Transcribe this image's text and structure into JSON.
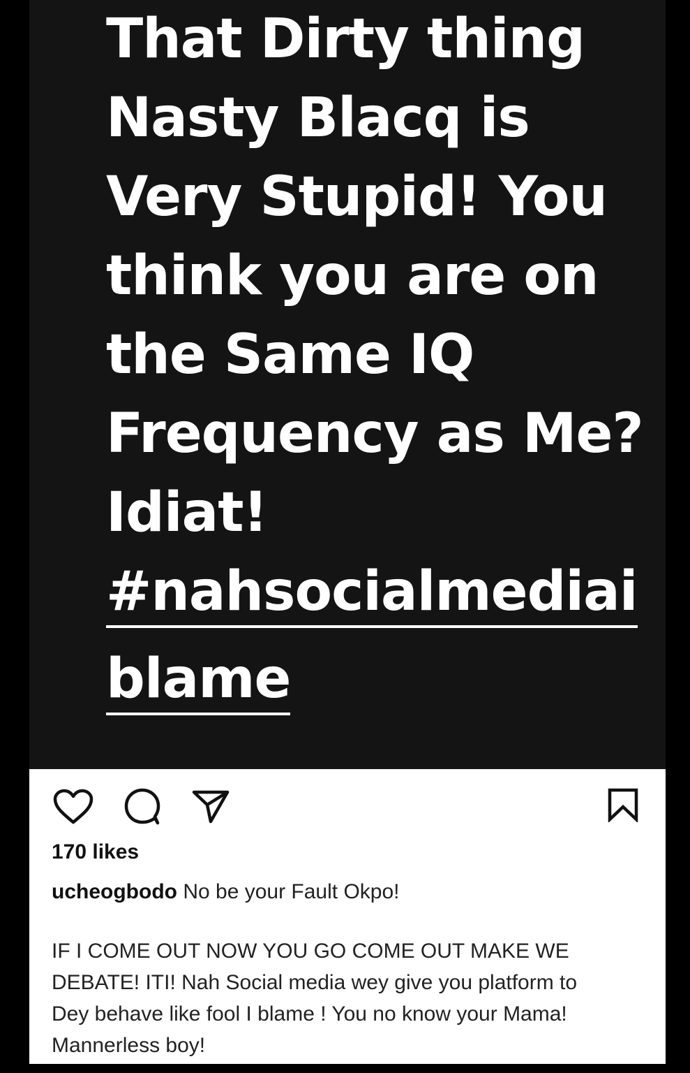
{
  "post": {
    "image_text_lines": [
      "That Dirty thing",
      "Nasty Blacq is",
      "Very Stupid!  You",
      "think you are on",
      "the Same IQ",
      "Frequency as Me?",
      "Idiat!"
    ],
    "hashtag_lines": [
      "#nahsocialmediai",
      "blame"
    ]
  },
  "actions": {
    "like_icon": "heart-icon",
    "comment_icon": "comment-bubble-icon",
    "share_icon": "paper-plane-icon",
    "save_icon": "bookmark-icon"
  },
  "likes": "170 likes",
  "caption": {
    "username": "ucheogbodo",
    "first_line": "No be your Fault Okpo!",
    "body_lines": [
      "IF I COME OUT NOW YOU GO COME OUT MAKE WE",
      "DEBATE!  ITI! Nah Social media wey give you platform to",
      "Dey behave like fool I blame ! You no know your Mama!",
      "Mannerless boy!"
    ]
  },
  "colors": {
    "background": "#000000",
    "image_background": "#141414",
    "image_text": "#ffffff",
    "panel_background": "#ffffff",
    "text": "#222222"
  }
}
